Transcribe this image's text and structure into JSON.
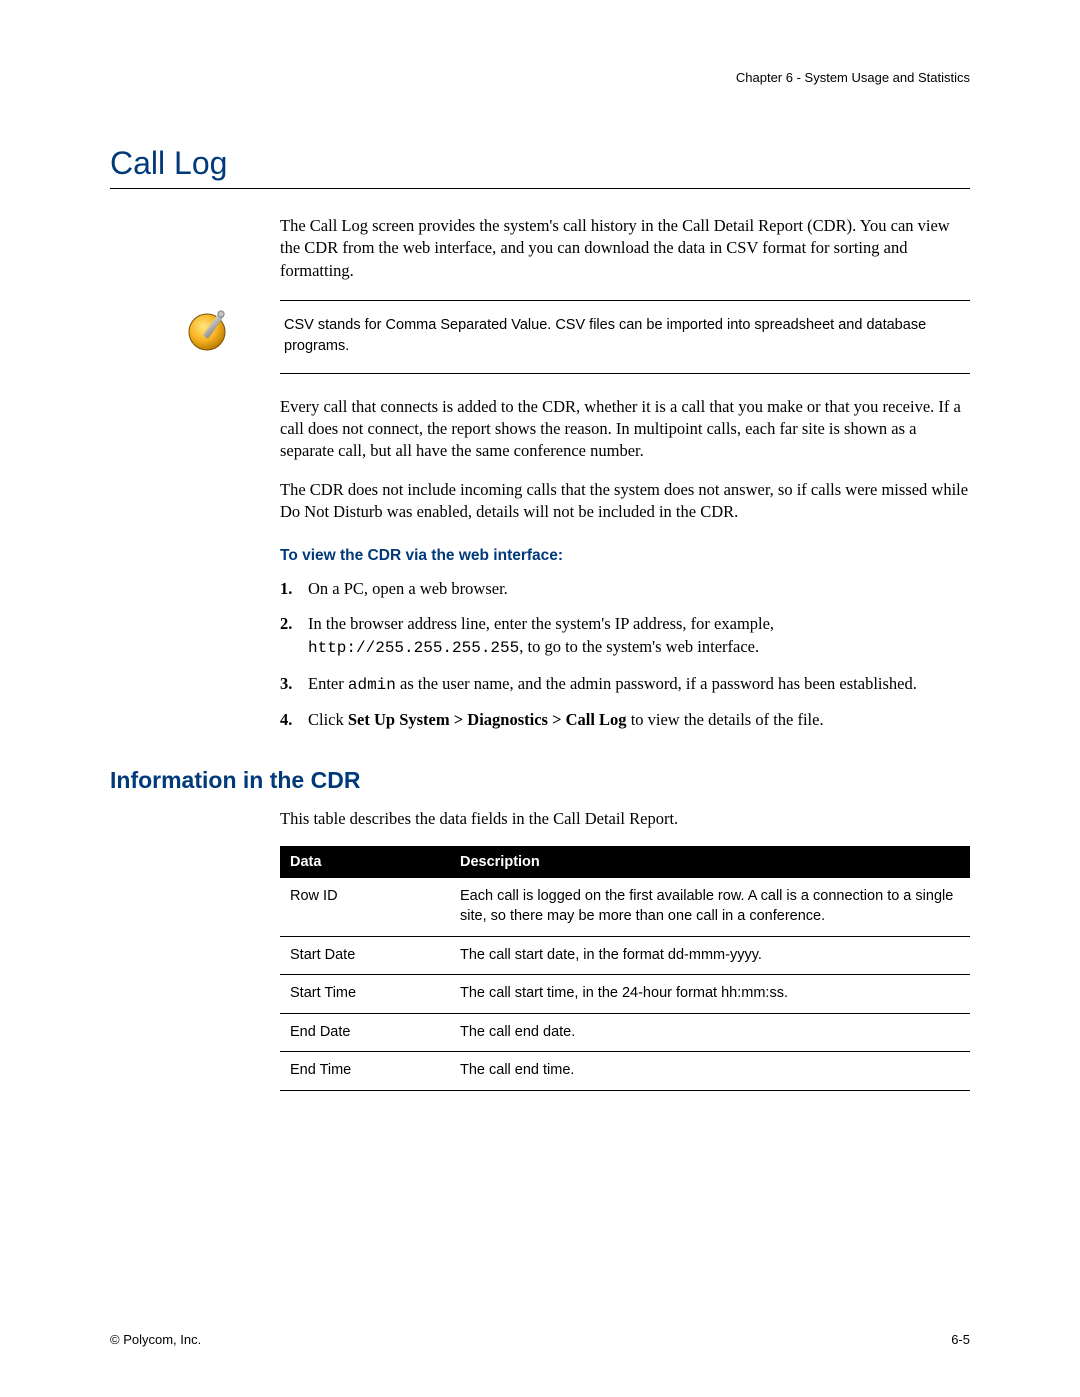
{
  "header": {
    "chapter": "Chapter 6 - System Usage and Statistics"
  },
  "section": {
    "title": "Call Log",
    "intro": "The Call Log screen provides the system's call history in the Call Detail Report (CDR). You can view the CDR from the web interface, and you can download the data in CSV format for sorting and formatting.",
    "note": "CSV stands for Comma Separated Value. CSV files can be imported into spreadsheet and database programs.",
    "para2": "Every call that connects is added to the CDR, whether it is a call that you make or that you receive. If a call does not connect, the report shows the reason. In multipoint calls, each far site is shown as a separate call, but all have the same conference number.",
    "para3": "The CDR does not include incoming calls that the system does not answer, so if calls were missed while Do Not Disturb was enabled, details will not be included in the CDR.",
    "task_heading": "To view the CDR via the web interface:",
    "steps": {
      "s1": "On a PC, open a web browser.",
      "s2_a": "In the browser address line, enter the system's IP address, for example, ",
      "s2_code": "http://255.255.255.255",
      "s2_b": ", to go to the system's web interface.",
      "s3_a": "Enter ",
      "s3_code": "admin",
      "s3_b": " as the user name, and the admin password, if a password has been established.",
      "s4_a": "Click ",
      "s4_bold": "Set Up System > Diagnostics > Call Log",
      "s4_b": " to view the details of the file."
    }
  },
  "subsection": {
    "title": "Information in the CDR",
    "intro": "This table describes the data fields in the Call Detail Report.",
    "table": {
      "head_data": "Data",
      "head_desc": "Description",
      "rows": [
        {
          "data": "Row ID",
          "desc": "Each call is logged on the first available row. A call is a connection to a single site, so there may be more than one call in a conference."
        },
        {
          "data": "Start Date",
          "desc": "The call start date, in the format dd-mmm-yyyy."
        },
        {
          "data": "Start Time",
          "desc": "The call start time, in the 24-hour format hh:mm:ss."
        },
        {
          "data": "End Date",
          "desc": "The call end date."
        },
        {
          "data": "End Time",
          "desc": "The call end time."
        }
      ]
    }
  },
  "footer": {
    "copyright": "© Polycom, Inc.",
    "page": "6-5"
  }
}
